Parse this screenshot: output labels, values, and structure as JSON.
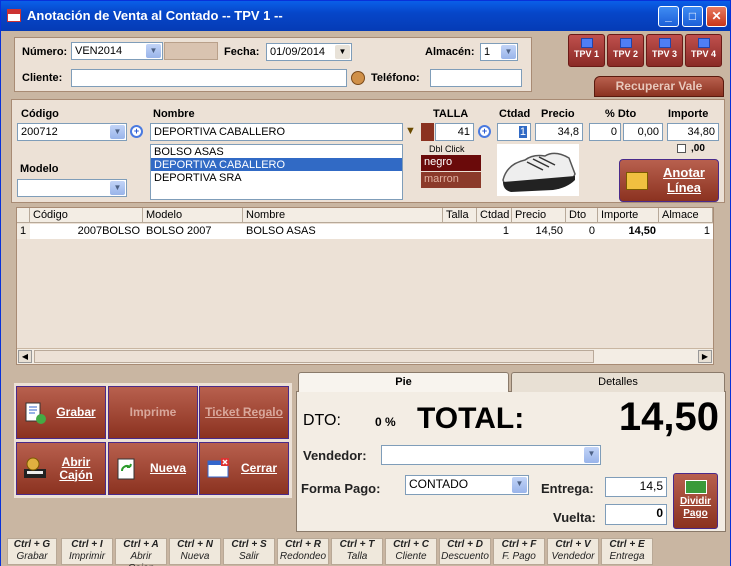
{
  "window": {
    "title": "Anotación de Venta al Contado -- TPV 1 --",
    "btn_min": "_",
    "btn_max": "□",
    "btn_close": "✕"
  },
  "header": {
    "numero_label": "Número:",
    "numero_value": "VEN2014",
    "fecha_label": "Fecha:",
    "fecha_value": "01/09/2014",
    "almacen_label": "Almacén:",
    "almacen_value": "1",
    "cliente_label": "Cliente:",
    "cliente_value": "",
    "telefono_label": "Teléfono:",
    "telefono_value": ""
  },
  "tpv_buttons": [
    "TPV 1",
    "TPV 2",
    "TPV 3",
    "TPV 4"
  ],
  "recuperar_vale": "Recuperar Vale",
  "line": {
    "codigo_label": "Código",
    "codigo_value": "200712",
    "nombre_label": "Nombre",
    "nombre_value": "DEPORTIVA CABALLERO",
    "talla_label": "TALLA",
    "talla_value": "41",
    "ctdad_label": "Ctdad",
    "ctdad_value": "1",
    "precio_label": "Precio",
    "precio_value": "34,8",
    "dto_label": "% Dto",
    "dto_pct": "0",
    "dto_value": "0,00",
    "importe_label": "Importe",
    "importe_value": "34,80",
    "decimals_label": ",00",
    "modelo_label": "Modelo",
    "modelo_value": "",
    "dbl_click": "Dbl Click",
    "colors": [
      "negro",
      "marron"
    ],
    "suggestions": [
      "BOLSO ASAS",
      "DEPORTIVA CABALLERO",
      "DEPORTIVA SRA"
    ],
    "anotar_label": "Anotar Línea"
  },
  "grid": {
    "columns": [
      "Código",
      "Modelo",
      "Nombre",
      "Talla",
      "Ctdad",
      "Precio",
      "Dto",
      "Importe",
      "Almace"
    ],
    "rows": [
      {
        "n": "1",
        "codigo": "2007BOLSO",
        "modelo": "BOLSO 2007",
        "nombre": "BOLSO ASAS",
        "talla": "",
        "ctdad": "1",
        "precio": "14,50",
        "dto": "0",
        "importe": "14,50",
        "almacen": "1"
      }
    ]
  },
  "actions": {
    "grabar": "Grabar",
    "imprime": "Imprime",
    "ticket": "Ticket Regalo",
    "abrir": "Abrir Cajón",
    "nueva": "Nueva",
    "cerrar": "Cerrar"
  },
  "totals": {
    "tab_pie": "Pie",
    "tab_detalles": "Detalles",
    "dto_label": "DTO:",
    "dto_value": "0 %",
    "total_label": "TOTAL:",
    "total_value": "14,50",
    "vendedor_label": "Vendedor:",
    "vendedor_value": "",
    "forma_pago_label": "Forma Pago:",
    "forma_pago_value": "CONTADO",
    "entrega_label": "Entrega:",
    "entrega_value": "14,5",
    "vuelta_label": "Vuelta:",
    "vuelta_value": "0",
    "dividir_label": "Dividir Pago"
  },
  "shortcuts": [
    {
      "key": "Ctrl + G",
      "label": "Grabar"
    },
    {
      "key": "Ctrl + I",
      "label": "Imprimir"
    },
    {
      "key": "Ctrl + A",
      "label": "Abrir Cajon"
    },
    {
      "key": "Ctrl + N",
      "label": "Nueva"
    },
    {
      "key": "Ctrl + S",
      "label": "Salir"
    },
    {
      "key": "Ctrl + R",
      "label": "Redondeo"
    },
    {
      "key": "Ctrl + T",
      "label": "Talla"
    },
    {
      "key": "Ctrl + C",
      "label": "Cliente"
    },
    {
      "key": "Ctrl + D",
      "label": "Descuento"
    },
    {
      "key": "Ctrl + F",
      "label": "F. Pago"
    },
    {
      "key": "Ctrl + V",
      "label": "Vendedor"
    },
    {
      "key": "Ctrl + E",
      "label": "Entrega"
    }
  ],
  "colors": {
    "accent_maroon": "#8b3220",
    "title_blue": "#0646c9",
    "selection": "#316ac5"
  }
}
